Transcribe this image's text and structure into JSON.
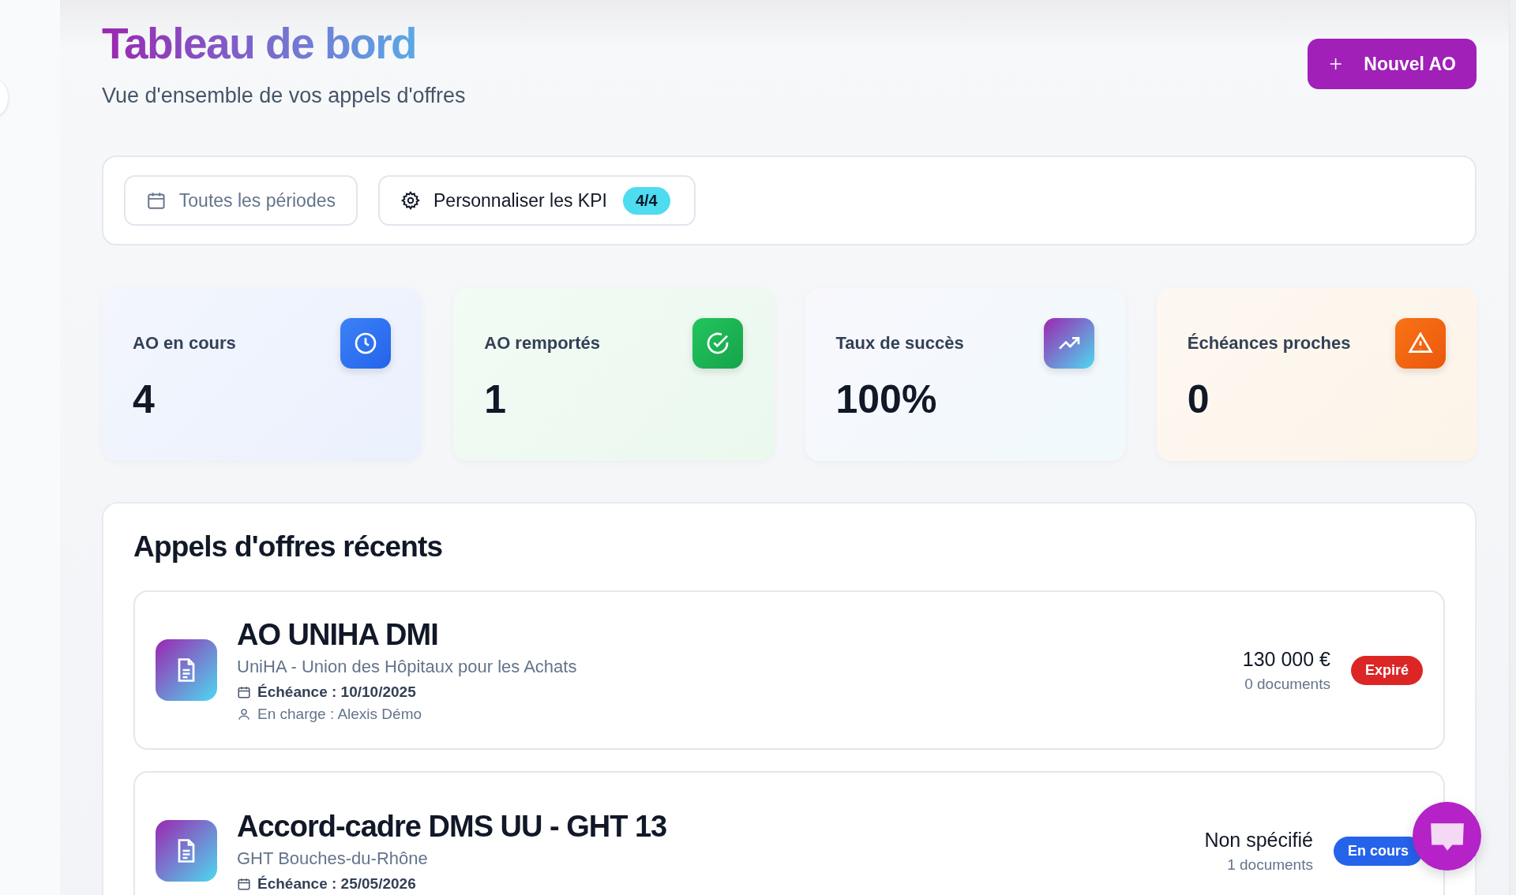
{
  "header": {
    "title": "Tableau de bord",
    "subtitle": "Vue d'ensemble de vos appels d'offres",
    "new_button": "Nouvel AO"
  },
  "filters": {
    "period": "Toutes les périodes",
    "kpi_button": "Personnaliser les KPI",
    "kpi_count": "4/4"
  },
  "kpis": [
    {
      "label": "AO en cours",
      "value": "4",
      "kind": "clock"
    },
    {
      "label": "AO remportés",
      "value": "1",
      "kind": "check"
    },
    {
      "label": "Taux de succès",
      "value": "100%",
      "kind": "trend"
    },
    {
      "label": "Échéances proches",
      "value": "0",
      "kind": "alert"
    }
  ],
  "recent": {
    "title": "Appels d'offres récents",
    "items": [
      {
        "title": "AO UNIHA DMI",
        "buyer": "UniHA - Union des Hôpitaux pour les Achats",
        "deadline": "Échéance : 10/10/2025",
        "owner": "En charge : Alexis Démo",
        "amount": "130 000 €",
        "documents": "0 documents",
        "status": "Expiré",
        "kind": "expired"
      },
      {
        "title": "Accord-cadre DMS UU - GHT 13",
        "buyer": "GHT Bouches-du-Rhône",
        "deadline": "Échéance : 25/05/2026",
        "amount": "Non spécifié",
        "documents": "1 documents",
        "status": "En cours",
        "kind": "in_progress"
      }
    ]
  }
}
